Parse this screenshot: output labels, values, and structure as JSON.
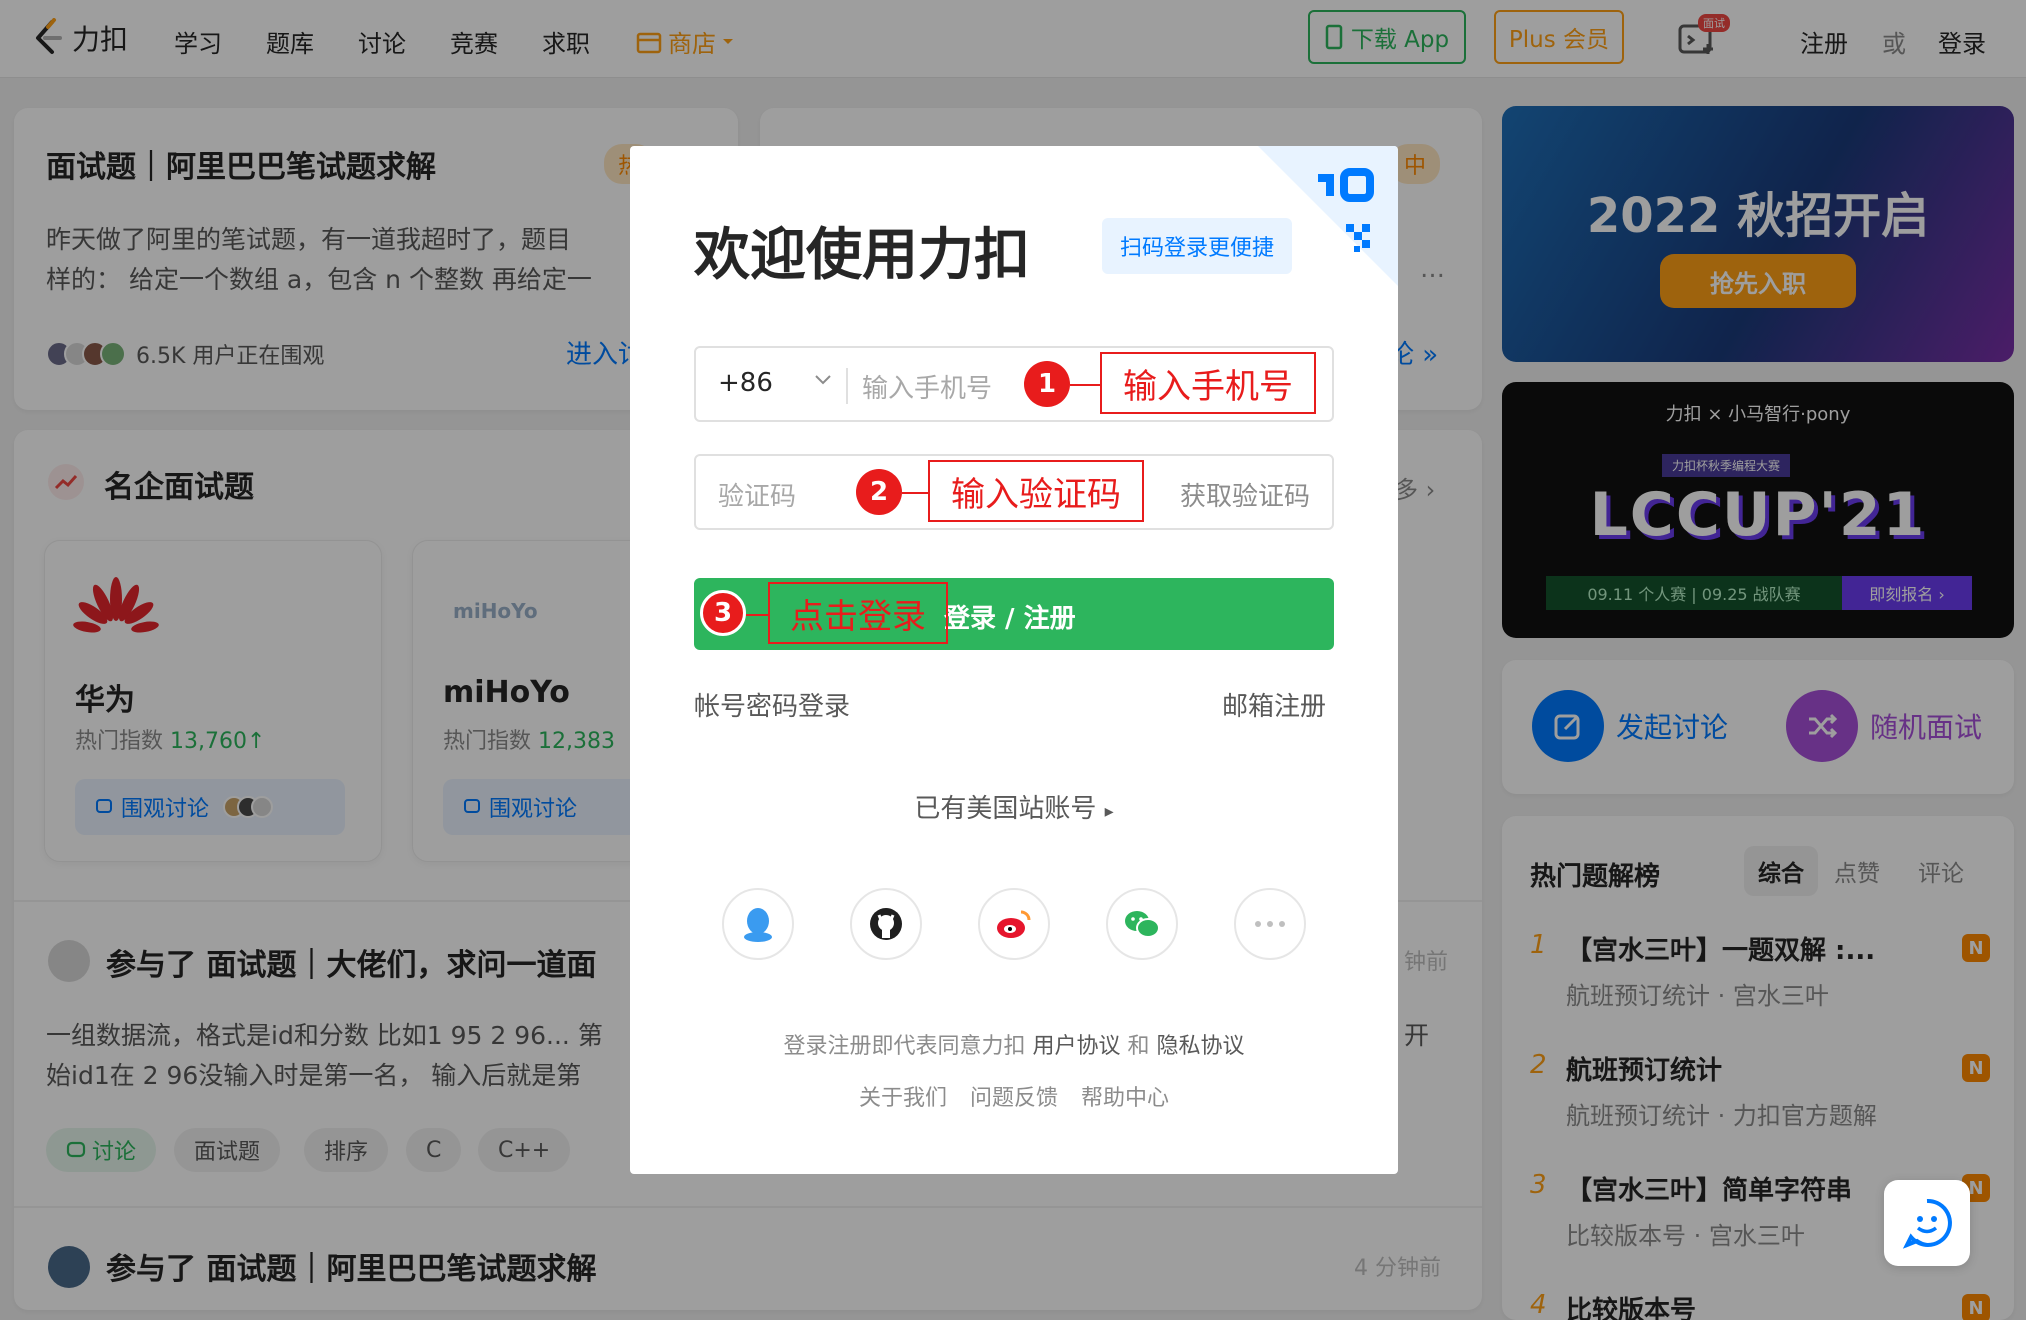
{
  "nav": {
    "brand": "力扣",
    "links": [
      "学习",
      "题库",
      "讨论",
      "竞赛",
      "求职"
    ],
    "store": "商店",
    "download_app": "下载 App",
    "plus": "Plus 会员",
    "interview_badge": "面试",
    "register": "注册",
    "or": "或",
    "login": "登录"
  },
  "feed": {
    "post1_title": "面试题｜阿里巴巴笔试题求解",
    "post1_tag": "热",
    "post1_line1": "昨天做了阿里的笔试题，有一道我超时了，题目",
    "post1_line2": "样的： 给定一个数组 a，包含 n 个整数 再给定一",
    "post1_watching": "6.5K 用户正在围观",
    "post1_enter": "进入讨",
    "post2_tag": "中",
    "post2_line": "…",
    "post2_link": "论 »",
    "companies_title": "名企面试题",
    "more": "多 ›",
    "company1_name": "华为",
    "company1_hot_label": "热门指数",
    "company1_hot_value": "13,760↑",
    "company1_watch": "围观讨论",
    "company2_name": "miHoYo",
    "company2_logo": "miHoYo",
    "company2_hot_label": "热门指数",
    "company2_hot_value": "12,383",
    "company2_watch": "围观讨论",
    "activity1_title": "参与了 面试题｜大佬们，求问一道面",
    "activity1_time": "钟前",
    "activity1_line1": "一组数据流，格式是id和分数 比如1 95 2 96... 第",
    "activity1_line2": "始id1在 2 96没输入时是第一名， 输入后就是第",
    "activity1_line_right": "开",
    "tags": [
      "讨论",
      "面试题",
      "排序",
      "C",
      "C++"
    ],
    "activity2_title": "参与了 面试题｜阿里巴巴笔试题求解",
    "activity2_time": "4 分钟前"
  },
  "right": {
    "banner1_title": "2022 秋招开启",
    "banner1_cta": "抢先入职",
    "banner2_brand": "力扣 × 小马智行·pony",
    "banner2_sub": "力扣杯秋季编程大赛",
    "banner2_title": "LCCUP'21",
    "banner2_dates": "09.11 个人赛 | 09.25 战队赛",
    "banner2_cta": "即刻报名 ›",
    "action1": "发起讨论",
    "action2": "随机面试",
    "rank_title": "热门题解榜",
    "rank_tabs": [
      "综合",
      "点赞",
      "评论"
    ],
    "rank_items": [
      {
        "num": "1",
        "title": "【宫水三叶】一题双解 :...",
        "sub": "航班预订统计 · 宫水三叶"
      },
      {
        "num": "2",
        "title": "航班预订统计",
        "sub": "航班预订统计 · 力扣官方题解"
      },
      {
        "num": "3",
        "title": "【宫水三叶】简单字符串",
        "sub": "比较版本号 · 宫水三叶"
      },
      {
        "num": "4",
        "title": "比较版本号",
        "sub": ""
      }
    ],
    "rank_badge": "N"
  },
  "modal": {
    "title": "欢迎使用力扣",
    "qr_hint": "扫码登录更便捷",
    "country_code": "+86",
    "phone_placeholder": "输入手机号",
    "code_placeholder": "验证码",
    "get_code": "获取验证码",
    "login_button": "登录 / 注册",
    "password_login": "帐号密码登录",
    "email_register": "邮箱注册",
    "us_account": "已有美国站账号",
    "terms_prefix": "登录注册即代表同意力扣",
    "user_agreement": "用户协议",
    "and": "和",
    "privacy": "隐私协议",
    "footer_links": [
      "关于我们",
      "问题反馈",
      "帮助中心"
    ]
  },
  "annotations": {
    "step1_num": "1",
    "step1_text": "输入手机号",
    "step2_num": "2",
    "step2_text": "输入验证码",
    "step3_num": "3",
    "step3_text": "点击登录",
    "color": "#e81c1c"
  },
  "colors": {
    "brand_green": "#2db55d",
    "brand_orange": "#ffa116",
    "link_blue": "#007aff"
  }
}
